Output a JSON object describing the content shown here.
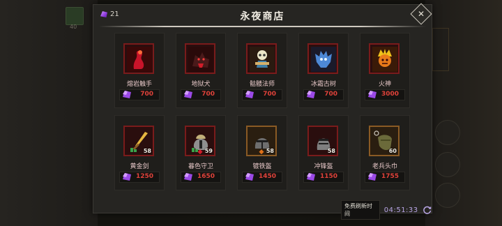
{
  "shop": {
    "title": "永夜商店",
    "currency_amount": "21",
    "refresh_label": "免费刷新时间",
    "refresh_time": "04:51:33"
  },
  "background": {
    "item_count": "40"
  },
  "items": [
    {
      "name": "熔岩触手",
      "price": "700",
      "level": "",
      "frame": "red",
      "icon": "lava-tentacle-icon"
    },
    {
      "name": "地狱犬",
      "price": "700",
      "level": "",
      "frame": "red",
      "icon": "hellhound-icon"
    },
    {
      "name": "骷髅法师",
      "price": "700",
      "level": "",
      "frame": "red",
      "icon": "skeleton-mage-icon"
    },
    {
      "name": "冰霜古树",
      "price": "700",
      "level": "",
      "frame": "red",
      "icon": "frost-ancient-icon"
    },
    {
      "name": "火神",
      "price": "3000",
      "level": "",
      "frame": "red",
      "icon": "fire-god-icon"
    },
    {
      "name": "黄金剑",
      "price": "1250",
      "level": "58",
      "frame": "red",
      "icon": "golden-sword-icon"
    },
    {
      "name": "暮色守卫",
      "price": "1650",
      "level": "59",
      "frame": "red",
      "icon": "twilight-helmet-icon"
    },
    {
      "name": "镀铁盔",
      "price": "1450",
      "level": "58",
      "frame": "orange",
      "icon": "iron-helmet-icon"
    },
    {
      "name": "冲锋盔",
      "price": "1150",
      "level": "58",
      "frame": "red",
      "icon": "charge-helmet-icon"
    },
    {
      "name": "老兵头巾",
      "price": "1755",
      "level": "60",
      "frame": "orange",
      "icon": "veteran-headscarf-icon"
    }
  ],
  "colors": {
    "price": "#e0423a",
    "gem": "#9a49e6",
    "frame_red": "#7a1b1b",
    "frame_orange": "#8a5a24"
  }
}
